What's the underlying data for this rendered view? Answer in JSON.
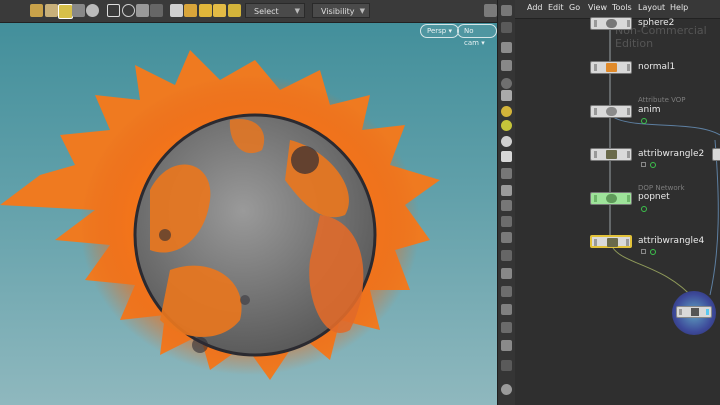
{
  "viewport": {
    "select_dropdown": "Select",
    "visibility_dropdown": "Visibility",
    "persp_label": "Persp",
    "cam_label": "No cam"
  },
  "network": {
    "menu": [
      "Add",
      "Edit",
      "Go",
      "View",
      "Tools",
      "Layout",
      "Help"
    ],
    "watermark": "Non-Commercial Edition",
    "nodes": [
      {
        "name": "sphere2",
        "type": ""
      },
      {
        "name": "normal1",
        "type": ""
      },
      {
        "name": "anim",
        "type": "Attribute VOP"
      },
      {
        "name": "attribwrangle2",
        "type": ""
      },
      {
        "name": "popnet",
        "type": "DOP Network"
      },
      {
        "name": "attribwrangle4",
        "type": ""
      }
    ]
  },
  "colors": {
    "particles_orange": "#f07a1e",
    "viewport_bg": "#4f97a2",
    "node_green": "#9ee39a",
    "node_gray": "#d9d9d9",
    "selected_border": "#e2c23a"
  }
}
